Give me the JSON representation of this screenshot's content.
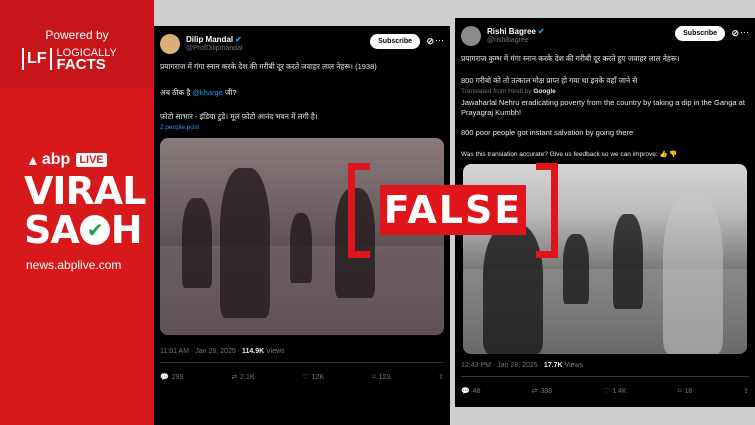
{
  "branding": {
    "powered_by": "Powered by",
    "lf_mark": "LF",
    "lf_line1": "LOGICALLY",
    "lf_line2": "FACTS",
    "abp": "abp",
    "live": "LIVE",
    "viral": "VIRAL",
    "sach_1": "SA",
    "sach_2": "H",
    "site": "news.abplive.com"
  },
  "stamp": {
    "label": "FALSE"
  },
  "tweet1": {
    "name": "Dilip Mandal",
    "handle": "@ProfDilipmandal",
    "subscribe": "Subscribe",
    "line1": "प्रयागराज में गंगा स्नान करके देश की गरीबी दूर करते जवाहर लाल नेहरू। (1938)",
    "line2_prefix": "अब ठीक है ",
    "line2_mention": "@kharge",
    "line2_suffix": " जी?",
    "line3": "फ़ोटो साभार - इंडिया टुडे। मूल फ़ोटो आनंद भवन में लगी है।",
    "link": "2.people.post",
    "time": "11:01 AM · Jan 28, 2025 · ",
    "views_count": "114.9K",
    "views_label": " Views",
    "replies": "293",
    "reposts": "2.1K",
    "likes": "12K",
    "bookmarks": "123"
  },
  "tweet2": {
    "name": "Rishi Bagree",
    "handle": "@rishibagree",
    "subscribe": "Subscribe",
    "line1": "प्रयागराज कुम्भ में गंगा स्नान करके देश की गरीबी दूर करते हुए जवाहर लाल नेहरू।",
    "line2": "800 गरीबो को तो तत्काल मोक्ष प्राप्त हो गया था इनके वहाँ जाने से",
    "translated": "Translated from Hindi by ",
    "google": "Google",
    "trans1": "Jawaharlal Nehru eradicating poverty from the country by taking a dip in the Ganga at Prayagraj Kumbh!",
    "trans2": "800 poor people got instant salvation by going there",
    "feedback": "Was this translation accurate? Give us feedback so we can improve:",
    "time": "12:43 PM · Jan 28, 2025 · ",
    "views_count": "17.7K",
    "views_label": " Views",
    "replies": "48",
    "reposts": "388",
    "likes": "1.4K",
    "bookmarks": "18"
  }
}
